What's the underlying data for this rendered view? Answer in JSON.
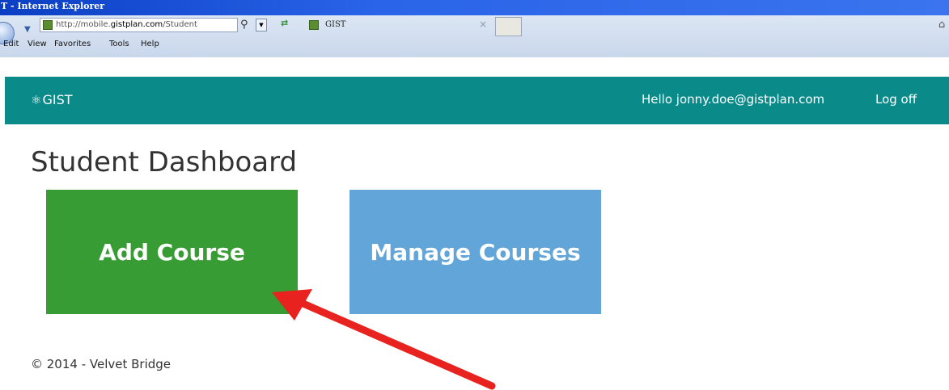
{
  "browser": {
    "window_title": "T - Internet Explorer",
    "url_prefix": "http://mobile.",
    "url_host": "gistplan.com",
    "url_path": "/Student",
    "tab_label": "GIST",
    "menu": [
      "Edit",
      "View",
      "Favorites",
      "Tools",
      "Help"
    ]
  },
  "site": {
    "logo_text": "GIST",
    "greeting": "Hello jonny.doe@gistplan.com",
    "logoff_label": "Log off"
  },
  "page": {
    "title": "Student Dashboard",
    "tiles": {
      "add_course": "Add Course",
      "manage_courses": "Manage Courses"
    },
    "footer": "© 2014 - Velvet Bridge"
  },
  "colors": {
    "header": "#0b8a8a",
    "add_course_tile": "#379c34",
    "manage_courses_tile": "#62a5d9",
    "annotation_arrow": "#e8231f"
  }
}
